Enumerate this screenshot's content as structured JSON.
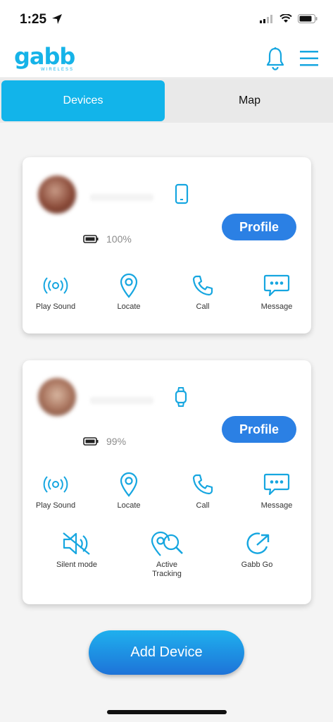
{
  "status_bar": {
    "time": "1:25"
  },
  "logo": {
    "text": "gabb",
    "subtext": "WIRELESS"
  },
  "tabs": [
    {
      "label": "Devices",
      "active": true
    },
    {
      "label": "Map",
      "active": false
    }
  ],
  "colors": {
    "accent": "#12b4ea",
    "profile_button": "#2b80e4",
    "icon": "#16a6e0"
  },
  "devices": [
    {
      "device_type_icon": "phone-icon",
      "battery": "100%",
      "profile_label": "Profile",
      "actions": [
        {
          "label": "Play Sound",
          "icon": "sound-waves-icon"
        },
        {
          "label": "Locate",
          "icon": "location-pin-icon"
        },
        {
          "label": "Call",
          "icon": "phone-handset-icon"
        },
        {
          "label": "Message",
          "icon": "chat-bubble-icon"
        }
      ]
    },
    {
      "device_type_icon": "watch-icon",
      "battery": "99%",
      "profile_label": "Profile",
      "actions": [
        {
          "label": "Play Sound",
          "icon": "sound-waves-icon"
        },
        {
          "label": "Locate",
          "icon": "location-pin-icon"
        },
        {
          "label": "Call",
          "icon": "phone-handset-icon"
        },
        {
          "label": "Message",
          "icon": "chat-bubble-icon"
        }
      ],
      "extra_actions": [
        {
          "label": "Silent mode",
          "icon": "muted-speaker-icon"
        },
        {
          "label": "Active\nTracking",
          "icon": "tracking-search-icon"
        },
        {
          "label": "Gabb Go",
          "icon": "gabb-go-icon"
        }
      ]
    }
  ],
  "add_device_label": "Add Device"
}
